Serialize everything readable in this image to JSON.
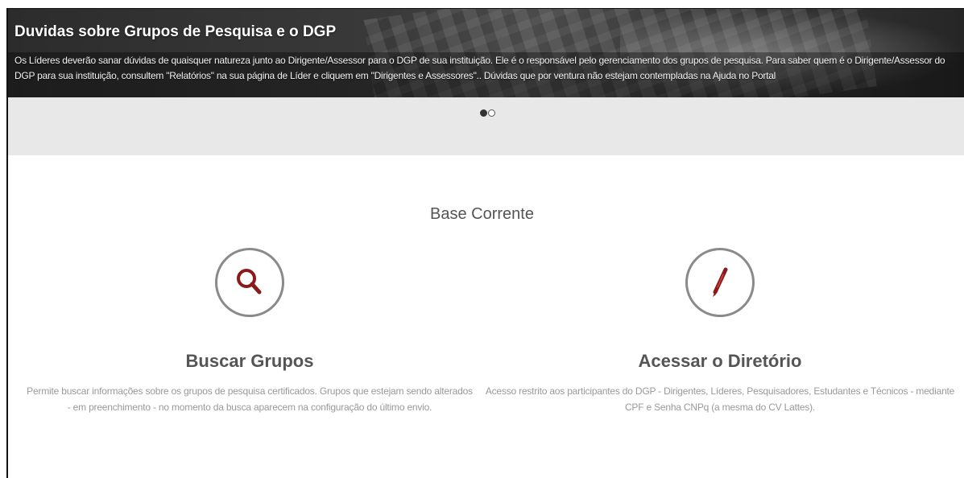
{
  "banner": {
    "title": "Duvidas sobre Grupos de Pesquisa e o DGP",
    "text": "Os Líderes deverão sanar dúvidas de quaisquer natureza junto ao Dirigente/Assessor para o DGP de sua instituição. Ele é o responsável pelo gerenciamento dos grupos de pesquisa. Para saber quem é o Dirigente/Assessor do DGP para sua instituição, consultem \"Relatórios\" na sua página de Líder e cliquem em \"Dirigentes e Assessores\".. Dúvidas que por ventura não estejam contempladas na Ajuda no Portal"
  },
  "carousel": {
    "slides": 2,
    "active_index": 0
  },
  "main": {
    "section_title": "Base Corrente",
    "cards": [
      {
        "icon": "search-icon",
        "title": "Buscar Grupos",
        "description": "Permite buscar informações sobre os grupos de pesquisa certificados. Grupos que estejam sendo alterados - em preenchimento - no momento da busca aparecem na configuração do último envio."
      },
      {
        "icon": "pen-icon",
        "title": "Acessar o Diretório",
        "description": "Acesso restrito aos participantes do DGP - Dirigentes, Líderes, Pesquisadores, Estudantes e Técnicos - mediante CPF e Senha CNPq (a mesma do CV Lattes)."
      }
    ]
  },
  "colors": {
    "icon_accent": "#8b1a1a",
    "circle_border": "#8a8a8a",
    "carousel_bg": "#e8e8e8"
  }
}
